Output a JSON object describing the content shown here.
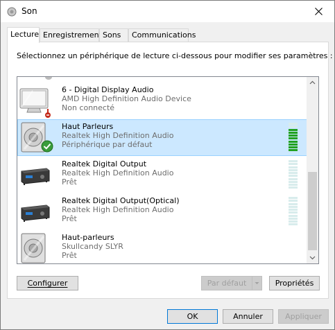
{
  "window": {
    "title": "Son"
  },
  "tabs": [
    {
      "label": "Lecture",
      "active": true
    },
    {
      "label": "Enregistrement",
      "active": false
    },
    {
      "label": "Sons",
      "active": false
    },
    {
      "label": "Communications",
      "active": false
    }
  ],
  "instructions": "Sélectionnez un périphérique de lecture ci-dessous pour modifier ses paramètres :",
  "devices": [
    {
      "name": "6 - Digital Display Audio",
      "driver": "AMD High Definition Audio Device",
      "status": "Non connecté",
      "icon": "monitor-icon",
      "badge": "disconnected-badge-icon",
      "selected": false,
      "meter_level": null
    },
    {
      "name": "Haut Parleurs",
      "driver": "Realtek High Definition Audio",
      "status": "Périphérique par défaut",
      "icon": "speaker-icon",
      "badge": "default-check-icon",
      "selected": true,
      "meter_level": 0.75
    },
    {
      "name": "Realtek Digital Output",
      "driver": "Realtek High Definition Audio",
      "status": "Prêt",
      "icon": "receiver-icon",
      "selected": false,
      "meter_level": 0
    },
    {
      "name": "Realtek Digital Output(Optical)",
      "driver": "Realtek High Definition Audio",
      "status": "Prêt",
      "icon": "receiver-icon",
      "selected": false,
      "meter_level": 0
    },
    {
      "name": "Haut-parleurs",
      "driver": "Skullcandy SLYR",
      "status": "Prêt",
      "icon": "speaker-icon",
      "selected": false,
      "meter_level": null
    }
  ],
  "buttons": {
    "configure": "Configurer",
    "set_default": "Par défaut",
    "properties": "Propriétés",
    "ok": "OK",
    "cancel": "Annuler",
    "apply": "Appliquer"
  },
  "colors": {
    "meter_active": "#21a121",
    "meter_idle": "#d8ecec",
    "selection": "#cce8ff",
    "default_check": "#3a9c3a",
    "disconnected": "#c42b1c"
  }
}
